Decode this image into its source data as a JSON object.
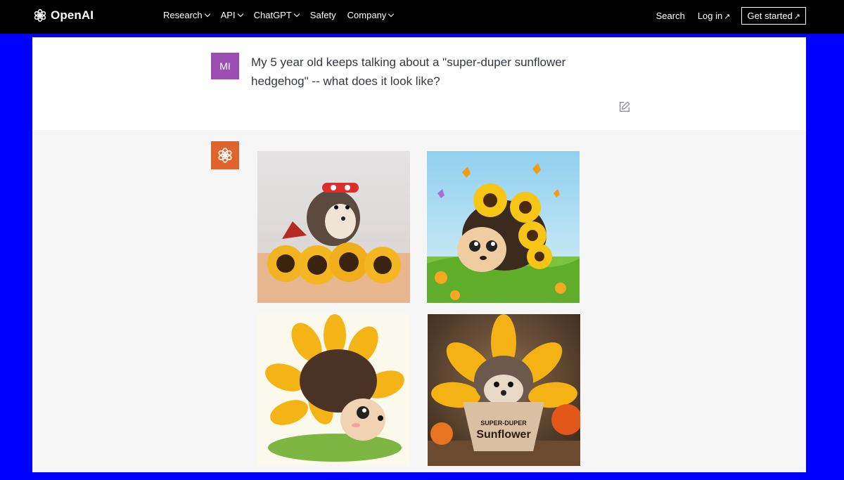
{
  "header": {
    "brand": "OpenAI",
    "nav": [
      {
        "label": "Research",
        "has_menu": true
      },
      {
        "label": "API",
        "has_menu": true
      },
      {
        "label": "ChatGPT",
        "has_menu": true
      },
      {
        "label": "Safety",
        "has_menu": false
      },
      {
        "label": "Company",
        "has_menu": true
      }
    ],
    "search_label": "Search",
    "login_label": "Log in",
    "get_started_label": "Get started"
  },
  "conversation": {
    "user": {
      "avatar_initials": "MI",
      "avatar_color": "#9b4fb3",
      "message": "My 5 year old keeps talking about a \"super-duper sunflower hedgehog\" -- what does it look like?"
    },
    "assistant": {
      "avatar_color": "#e0622d",
      "images": [
        {
          "alt": "hedgehog with red mask and cape on sunflowers"
        },
        {
          "alt": "cartoon hedgehog with sunflowers and butterflies"
        },
        {
          "alt": "illustrated hedgehog in sunflower petals"
        },
        {
          "alt": "hedgehog in sunflower pot",
          "pot_text_line1": "SUPER-DUPER",
          "pot_text_line2": "Sunflower"
        }
      ]
    }
  },
  "colors": {
    "page_bg": "#0000ff",
    "header_bg": "#000000",
    "assistant_bg": "#f6f6f7"
  }
}
